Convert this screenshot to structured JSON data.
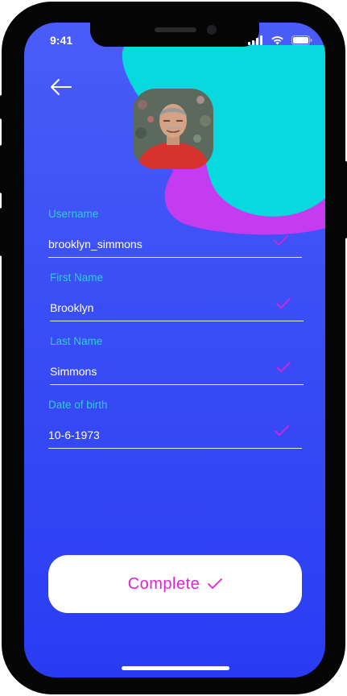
{
  "status_bar": {
    "time": "9:41"
  },
  "profile": {
    "avatar_alt": "profile photo"
  },
  "form": {
    "fields": [
      {
        "label": "Username",
        "value": "brooklyn_simmons",
        "valid": true
      },
      {
        "label": "First Name",
        "value": "Brooklyn",
        "valid": true
      },
      {
        "label": "Last Name",
        "value": "Simmons",
        "valid": true
      },
      {
        "label": "Date of birth",
        "value": "10-6-1973",
        "valid": true
      }
    ]
  },
  "actions": {
    "complete_label": "Complete"
  },
  "colors": {
    "background_top": "#4a5cf8",
    "background_bottom": "#2a3cf3",
    "blob_cyan": "#07d9de",
    "blob_magenta": "#c43bf0",
    "label_teal": "#2ad1c9",
    "check_magenta": "#e020d8",
    "button_text": "#e020d8"
  },
  "icons": {
    "back": "arrow-left-icon",
    "check": "checkmark-icon",
    "signal": "cellular-signal-icon",
    "wifi": "wifi-icon",
    "battery": "battery-icon"
  }
}
